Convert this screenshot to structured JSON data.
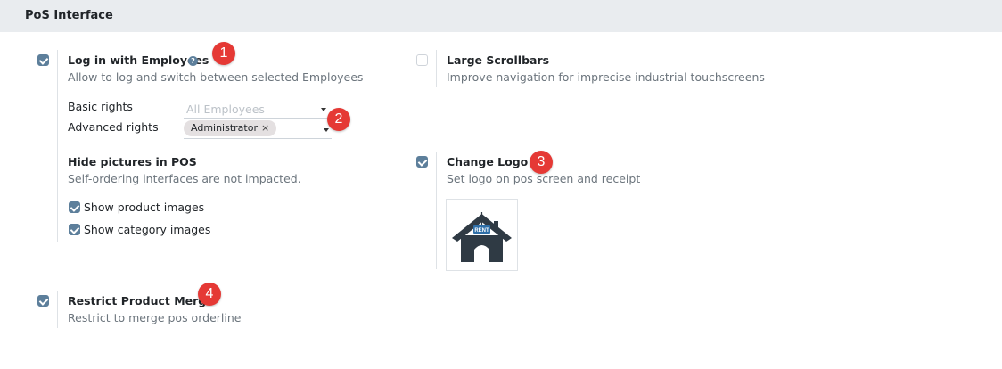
{
  "section": {
    "title": "PoS Interface"
  },
  "login_employees": {
    "checked": true,
    "title": "Log in with Employees",
    "help_icon": "question-circle-icon",
    "description": "Allow to log and switch between selected Employees",
    "basic_rights": {
      "label": "Basic rights",
      "placeholder": "All Employees"
    },
    "advanced_rights": {
      "label": "Advanced rights",
      "tag": "Administrator",
      "tag_remove": "×"
    },
    "badge": "1",
    "badge2": "2"
  },
  "large_scrollbars": {
    "checked": false,
    "title": "Large Scrollbars",
    "description": "Improve navigation for imprecise industrial touchscreens"
  },
  "hide_pictures": {
    "title": "Hide pictures in POS",
    "description": "Self-ordering interfaces are not impacted.",
    "options": [
      {
        "label": "Show product images",
        "checked": true
      },
      {
        "label": "Show category images",
        "checked": true
      }
    ]
  },
  "change_logo": {
    "checked": true,
    "title": "Change Logo",
    "description": "Set logo on pos screen and receipt",
    "badge": "3",
    "logo": {
      "icon": "house-rent-icon",
      "sign_text": "RENT",
      "color": "#2f3a44"
    }
  },
  "restrict_merge": {
    "checked": true,
    "title": "Restrict Product Merge",
    "description": "Restrict to merge pos orderline",
    "badge": "4"
  },
  "colors": {
    "accent": "#5d7f9b",
    "badge": "#e53935",
    "header_bg": "#e9ecef"
  }
}
